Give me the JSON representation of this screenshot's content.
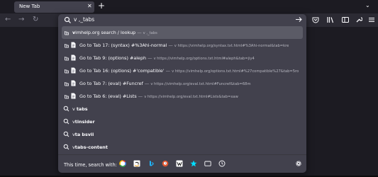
{
  "tab": {
    "title": "New Tab",
    "close_icon": "close-icon"
  },
  "newtab": {
    "label": "+"
  },
  "tabs_menu": {
    "icon": "chevron-down-icon",
    "glyph": "⌄"
  },
  "nav": {
    "back": "←",
    "forward": "→",
    "reload": "↻"
  },
  "urlbar": {
    "value": "v ,_tabs"
  },
  "results": [
    {
      "type": "search",
      "bold": "v",
      "text": "imhelp.org search / lookup",
      "dash": "—",
      "url": "v ,_tabs",
      "selected": true
    },
    {
      "type": "tab",
      "text": "Go to Tab 17: (syntax) #%3Ahi-normal",
      "dash": "—",
      "url": "v https://vimhelp.org/syntax.txt.html#%3Ahi-normal&tab=kre"
    },
    {
      "type": "tab",
      "text": "Go to Tab 9: (options) #aleph",
      "dash": "—",
      "url": "v https://vimhelp.org/options.txt.html#aleph&tab=jiy4"
    },
    {
      "type": "tab",
      "text": "Go to Tab 16: (options) #'compatible'",
      "dash": "—",
      "url": "v https://vimhelp.org/options.txt.html#%27compatible%27&tab=5ro"
    },
    {
      "type": "tab",
      "text": "Go to Tab 7: (eval) #Funcref",
      "dash": "—",
      "url": "v https://vimhelp.org/eval.txt.html#Funcref&tab=68m"
    },
    {
      "type": "tab",
      "text": "Go to Tab 6: (eval) #Lists",
      "dash": "—",
      "url": "v https://vimhelp.org/eval.txt.html#Lists&tab=xaw"
    },
    {
      "type": "suggest",
      "plain": "v ",
      "bold": "tabs"
    },
    {
      "type": "suggest",
      "plain": "v",
      "bold": "tinsider"
    },
    {
      "type": "suggest",
      "plain": "v",
      "bold": "ta bsvii"
    },
    {
      "type": "suggest",
      "plain": "v",
      "bold": "tabs-content"
    }
  ],
  "searchbar": {
    "label": "This time, search with:",
    "engines": [
      "google-icon",
      "amazon-icon",
      "bing-icon",
      "duckduckgo-icon",
      "wikipedia-icon",
      "bookmarks-star-icon",
      "tabs-icon",
      "history-icon"
    ]
  },
  "colors": {
    "background": "#1c1b22",
    "panel": "#42414d",
    "selected_row": "#5b5b66",
    "accent": "#00ddff"
  }
}
